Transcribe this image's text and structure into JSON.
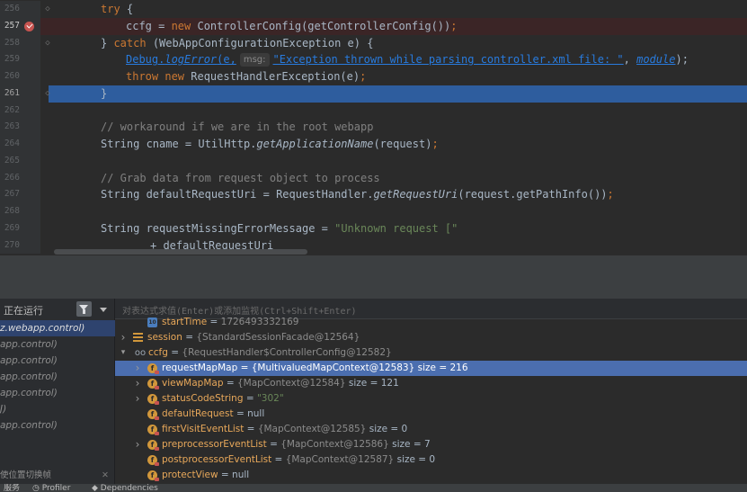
{
  "editor": {
    "lines": [
      {
        "num": "256",
        "fold": "◇",
        "indent": 1,
        "parts": [
          {
            "t": "try",
            "c": "kw"
          },
          {
            "t": " {",
            "c": ""
          }
        ]
      },
      {
        "num": "257",
        "breakpoint": true,
        "indent": 2,
        "exec": true,
        "parts": [
          {
            "t": "ccfg = ",
            "c": ""
          },
          {
            "t": "new ",
            "c": "kw"
          },
          {
            "t": "ControllerConfig(getControllerConfig())",
            "c": ""
          },
          {
            "t": ";",
            "c": "kw"
          }
        ]
      },
      {
        "num": "258",
        "fold": "◇",
        "indent": 1,
        "parts": [
          {
            "t": "} ",
            "c": ""
          },
          {
            "t": "catch ",
            "c": "kw"
          },
          {
            "t": "(WebAppConfigurationException e) {",
            "c": ""
          }
        ]
      },
      {
        "num": "259",
        "indent": 2,
        "parts": [
          {
            "t": "Debug.",
            "c": "link"
          },
          {
            "t": "logError",
            "c": "link fn"
          },
          {
            "t": "(e,",
            "c": "link"
          },
          {
            "t": "msg:",
            "c": "hint"
          },
          {
            "t": "\"Exception thrown while parsing controller.xml file: \"",
            "c": "str link"
          },
          {
            "t": ", ",
            "c": ""
          },
          {
            "t": "module",
            "c": "fld link"
          },
          {
            "t": ");",
            "c": ""
          }
        ]
      },
      {
        "num": "260",
        "indent": 2,
        "parts": [
          {
            "t": "throw new ",
            "c": "kw"
          },
          {
            "t": "RequestHandlerException(e)",
            "c": ""
          },
          {
            "t": ";",
            "c": "kw"
          }
        ]
      },
      {
        "num": "261",
        "fold": "◇",
        "indent": 1,
        "selected": true,
        "parts": [
          {
            "t": "}",
            "c": ""
          }
        ]
      },
      {
        "num": "262",
        "indent": 1,
        "parts": []
      },
      {
        "num": "263",
        "indent": 1,
        "parts": [
          {
            "t": "// workaround if we are in the root webapp",
            "c": "cm"
          }
        ]
      },
      {
        "num": "264",
        "indent": 1,
        "parts": [
          {
            "t": "String cname = UtilHttp.",
            "c": ""
          },
          {
            "t": "getApplicationName",
            "c": "fn"
          },
          {
            "t": "(request)",
            "c": ""
          },
          {
            "t": ";",
            "c": "kw"
          }
        ]
      },
      {
        "num": "265",
        "indent": 1,
        "parts": []
      },
      {
        "num": "266",
        "indent": 1,
        "parts": [
          {
            "t": "// Grab data from request object to process",
            "c": "cm"
          }
        ]
      },
      {
        "num": "267",
        "indent": 1,
        "parts": [
          {
            "t": "String defaultRequestUri = RequestHandler.",
            "c": ""
          },
          {
            "t": "getRequestUri",
            "c": "fn"
          },
          {
            "t": "(request.getPathInfo())",
            "c": ""
          },
          {
            "t": ";",
            "c": "kw"
          }
        ]
      },
      {
        "num": "268",
        "indent": 1,
        "parts": []
      },
      {
        "num": "269",
        "indent": 1,
        "parts": [
          {
            "t": "String requestMissingErrorMessage = ",
            "c": ""
          },
          {
            "t": "\"Unknown request [\"",
            "c": "str"
          }
        ]
      },
      {
        "num": "270",
        "indent": 3,
        "parts": [
          {
            "t": "+ defaultRequestUri",
            "c": ""
          }
        ]
      }
    ]
  },
  "frames": {
    "title": "正在运行",
    "items": [
      {
        "label": "z.webapp.control)",
        "selected": true
      },
      {
        "label": "app.control)"
      },
      {
        "label": "app.control)"
      },
      {
        "label": "app.control)"
      },
      {
        "label": "app.control)"
      },
      {
        "label": "J)"
      },
      {
        "label": "app.control)"
      }
    ],
    "footer": "使位置切换帧"
  },
  "variables": {
    "eval_placeholder": "对表达式求值(Enter)或添加监视(Ctrl+Shift+Enter)",
    "rows": [
      {
        "level": 1,
        "icon": "clk",
        "name": "startTime",
        "eq": " = ",
        "value": "1726493332169"
      },
      {
        "level": 0,
        "arrow": "›",
        "icon": "list",
        "name": "session",
        "eq": " = ",
        "value": "{StandardSessionFacade@12564}"
      },
      {
        "level": 0,
        "arrow": "⌄",
        "icon": "oo",
        "name": "ccfg",
        "eq": " = ",
        "value": "{RequestHandler$ControllerConfig@12582}"
      },
      {
        "level": 1,
        "arrow": "›",
        "icon": "f-lock",
        "name": "requestMapMap",
        "eq": " = ",
        "value": "{MultivaluedMapContext@12583}",
        "size": "size = 216",
        "selected": true
      },
      {
        "level": 1,
        "arrow": "›",
        "icon": "f-lock",
        "name": "viewMapMap",
        "eq": " = ",
        "value": "{MapContext@12584}",
        "size": "size = 121"
      },
      {
        "level": 1,
        "arrow": "›",
        "icon": "f-lock",
        "name": "statusCodeString",
        "eq": " = ",
        "str": "\"302\""
      },
      {
        "level": 1,
        "icon": "f-lock",
        "name": "defaultRequest",
        "eq": " = ",
        "plain": "null"
      },
      {
        "level": 1,
        "icon": "f-lock",
        "name": "firstVisitEventList",
        "eq": " = ",
        "value": "{MapContext@12585}",
        "size": "size = 0"
      },
      {
        "level": 1,
        "arrow": "›",
        "icon": "f-lock",
        "name": "preprocessorEventList",
        "eq": " = ",
        "value": "{MapContext@12586}",
        "size": "size = 7"
      },
      {
        "level": 1,
        "icon": "f-lock",
        "name": "postprocessorEventList",
        "eq": " = ",
        "value": "{MapContext@12587}",
        "size": "size = 0"
      },
      {
        "level": 1,
        "icon": "f-lock",
        "name": "protectView",
        "eq": " = ",
        "plain": "null"
      }
    ]
  },
  "status": {
    "items": [
      {
        "icon": "",
        "label": "服务"
      },
      {
        "icon": "◷",
        "label": "Profiler"
      },
      {
        "icon": "◆",
        "label": "Dependencies"
      }
    ]
  },
  "colors": {
    "selection": "#2e5d9e",
    "exec_line": "#3b2526",
    "breakpoint": "#c75450"
  }
}
